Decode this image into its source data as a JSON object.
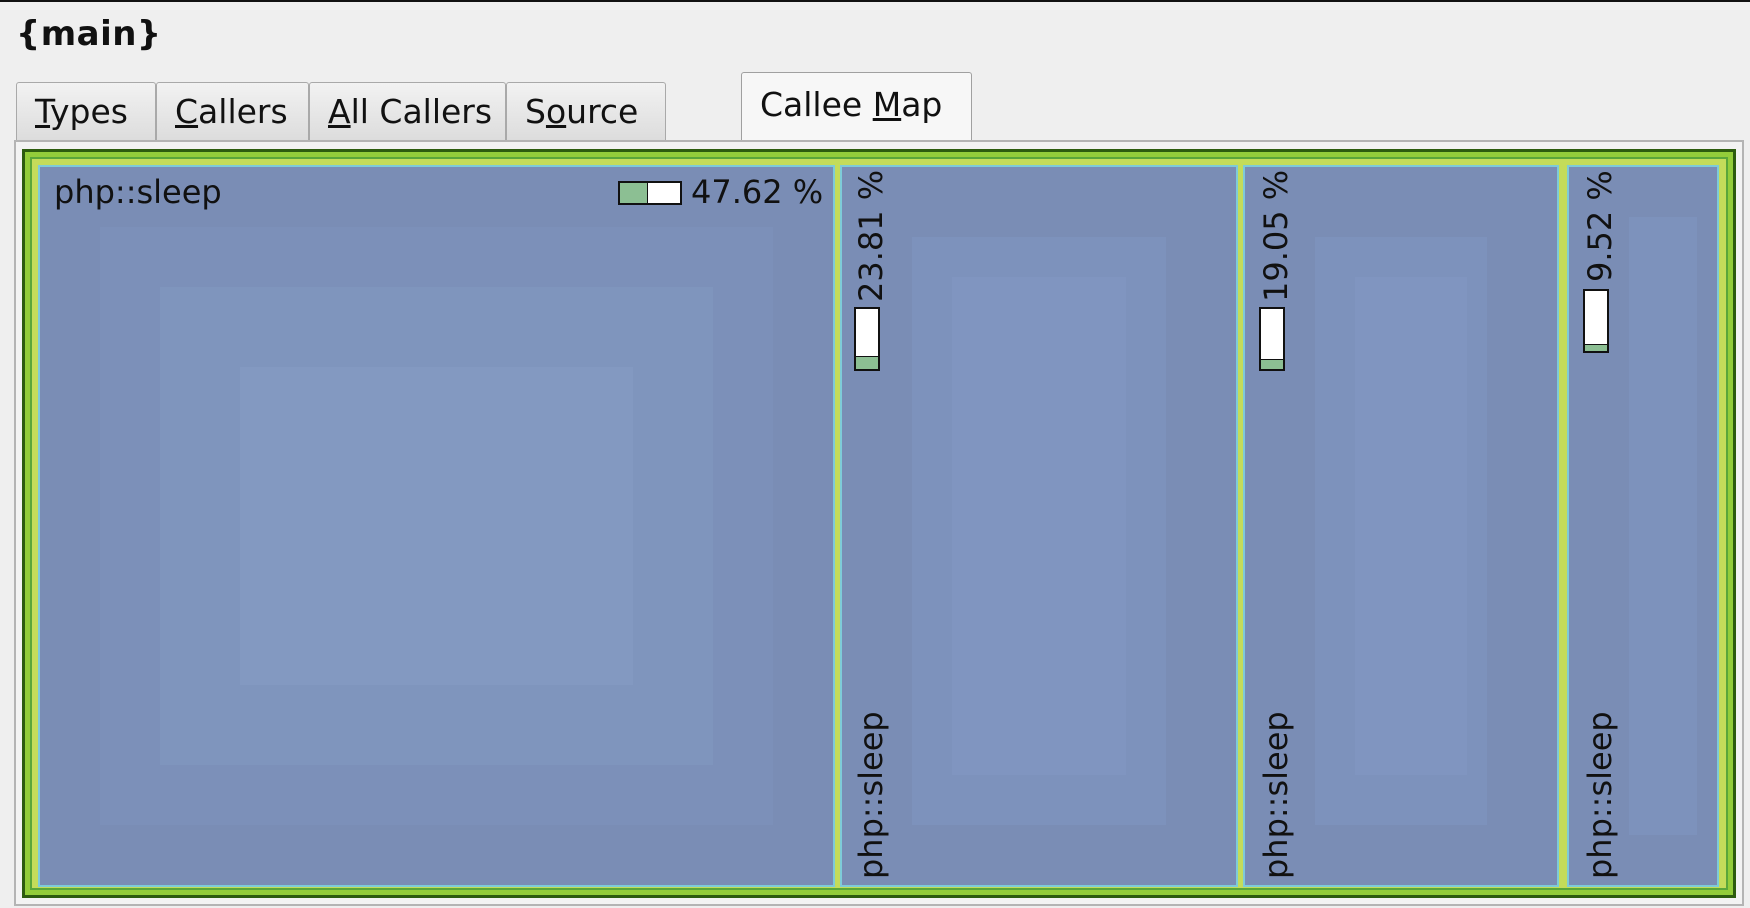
{
  "panel": {
    "title": "{main}"
  },
  "tabs": [
    {
      "pre": "",
      "acc": "T",
      "post": "ypes",
      "active": false
    },
    {
      "pre": "",
      "acc": "C",
      "post": "allers",
      "active": false
    },
    {
      "pre": "",
      "acc": "A",
      "post": "ll Callers",
      "active": false
    },
    {
      "pre": "S",
      "acc": "o",
      "post": "urce",
      "active": false
    },
    {
      "pre": "Callee ",
      "acc": "M",
      "post": "ap",
      "active": true
    }
  ],
  "callee_map": {
    "items": [
      {
        "name": "php::sleep",
        "percent_label": "47.62 %",
        "fraction": 0.4762,
        "orientation": "horizontal"
      },
      {
        "name": "php::sleep",
        "percent_label": "23.81 %",
        "fraction": 0.2381,
        "orientation": "vertical"
      },
      {
        "name": "php::sleep",
        "percent_label": "19.05 %",
        "fraction": 0.1905,
        "orientation": "vertical"
      },
      {
        "name": "php::sleep",
        "percent_label": "9.52 %",
        "fraction": 0.0952,
        "orientation": "vertical"
      }
    ],
    "colors": {
      "cell_fill": "#7a8db5",
      "cell_border": "#7ecbd8",
      "outer_fill": "#93cd3a",
      "bar_fill": "#8cbf93"
    }
  }
}
